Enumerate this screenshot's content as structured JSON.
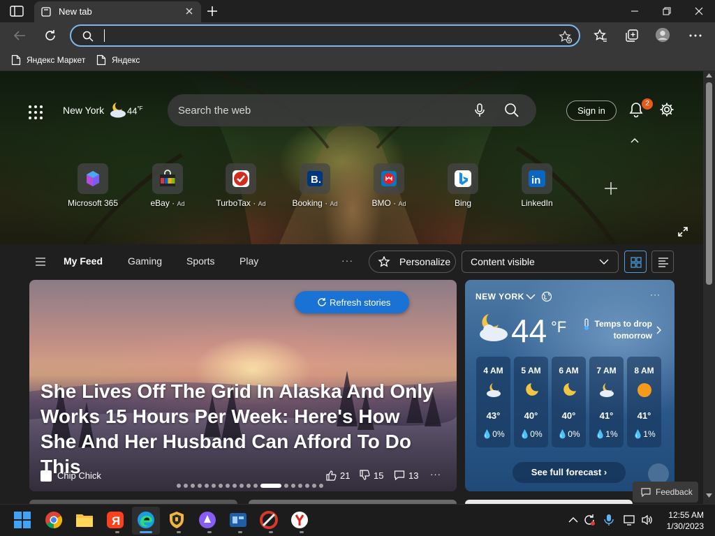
{
  "browser": {
    "tab_title": "New tab",
    "omnibox_value": "",
    "favorites": [
      "Яндекс Маркет",
      "Яндекс"
    ]
  },
  "hero": {
    "location": "New York",
    "temp": "44",
    "temp_unit": "°F",
    "search_placeholder": "Search the web",
    "sign_in": "Sign in",
    "notifications": "2",
    "quick_links": [
      {
        "label": "Microsoft 365",
        "ad": "",
        "icon": "microsoft365-icon"
      },
      {
        "label": "eBay",
        "ad": "Ad",
        "icon": "ebay-icon"
      },
      {
        "label": "TurboTax",
        "ad": "Ad",
        "icon": "turbotax-icon"
      },
      {
        "label": "Booking",
        "ad": "Ad",
        "icon": "booking-icon"
      },
      {
        "label": "BMO",
        "ad": "Ad",
        "icon": "bmo-icon"
      },
      {
        "label": "Bing",
        "ad": "",
        "icon": "bing-icon"
      },
      {
        "label": "LinkedIn",
        "ad": "",
        "icon": "linkedin-icon"
      }
    ]
  },
  "feed_nav": {
    "items": [
      "My Feed",
      "Gaming",
      "Sports",
      "Play"
    ],
    "more": "···",
    "personalize": "Personalize",
    "content_visibility": "Content visible"
  },
  "story": {
    "refresh": "Refresh stories",
    "title": "She Lives Off The Grid In Alaska And Only Works 15 Hours Per Week: Here's How She And Her Husband Can Afford To Do This",
    "source": "Chip Chick",
    "likes": "21",
    "dislikes": "15",
    "comments": "13",
    "more": "···",
    "slide_count": 19,
    "active_slide": 12
  },
  "weather": {
    "city": "NEW YORK",
    "temp": "44",
    "unit": "°F",
    "note": "Temps to drop tomorrow",
    "hours": [
      {
        "time": "4 AM",
        "icon": "moon-cloud-icon",
        "temp": "43°",
        "precip": "0%"
      },
      {
        "time": "5 AM",
        "icon": "moon-icon",
        "temp": "40°",
        "precip": "0%"
      },
      {
        "time": "6 AM",
        "icon": "moon-icon",
        "temp": "40°",
        "precip": "0%"
      },
      {
        "time": "7 AM",
        "icon": "moon-cloud-icon",
        "temp": "41°",
        "precip": "1%"
      },
      {
        "time": "8 AM",
        "icon": "sun-icon",
        "temp": "41°",
        "precip": "1%"
      }
    ],
    "full_forecast": "See full forecast",
    "more": "···"
  },
  "feedback": "Feedback",
  "taskbar": {
    "time": "12:55 AM",
    "date": "1/30/2023"
  },
  "colors": {
    "accent": "#1a73d4",
    "omnibox_border": "#7cb8ee",
    "badge": "#e8591a"
  }
}
